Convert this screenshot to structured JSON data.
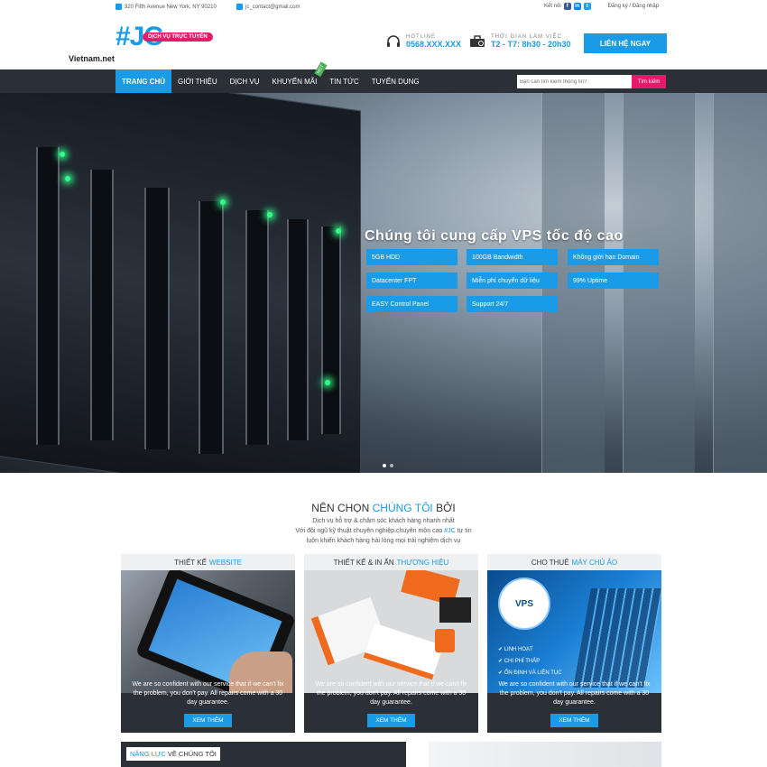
{
  "topbar": {
    "address": "320 Fifth Avenue New York, NY 90210",
    "email": "jc_contact@gmail.com",
    "connect_label": "Kết nối",
    "auth": "Đăng ký / Đăng nhập",
    "social": [
      "facebook-icon",
      "messenger-icon",
      "twitter-icon"
    ]
  },
  "header": {
    "logo_mark": "#JC",
    "logo_tag": "DỊCH VỤ TRỰC TUYẾN",
    "site_name": "Vietnam.net",
    "hotline_label": "HOTLINE",
    "hotline_value": "0568.XXX.XXX",
    "hours_label": "THỜI GIAN LÀM VIỆC",
    "hours_value": "T2 - T7: 8h30 - 20h30",
    "cta": "LIÊN HỆ NGAY"
  },
  "nav": {
    "items": [
      "TRANG CHỦ",
      "GIỚI THIỆU",
      "DỊCH VỤ",
      "KHUYẾN MÃI",
      "TIN TỨC",
      "TUYỂN DỤNG"
    ],
    "hot_badge": "HOT",
    "search_placeholder": "Bạn cần tìm kiếm thông tin?",
    "search_button": "Tìm kiếm"
  },
  "hero": {
    "title": "Chúng tôi cung cấp VPS tốc độ cao",
    "features": [
      "5GB HDD",
      "100GB Bandwidth",
      "Không giới hạn Domain",
      "Datacenter FPT",
      "Miễn phí chuyển dữ liệu",
      "99% Uptime",
      "EASY Control Panel",
      "Support 24/7"
    ]
  },
  "why": {
    "title_a": "NÊN CHỌN ",
    "title_hl": "CHÚNG TÔI",
    "title_b": " BỞI",
    "line1": "Dịch vụ hỗ trợ & chăm sóc khách hàng nhanh nhất",
    "line2_a": "Với đội ngũ kỹ thuật chuyên nghiệp,chuyên môn cao ",
    "line2_hl": "#JC",
    "line2_b": " tự tin",
    "line3": "luôn khiến khách hàng hài lòng mọi trải nghiệm dịch vụ"
  },
  "cards": [
    {
      "title": "THIẾT KẾ",
      "title_hl": "WEBSITE",
      "desc": "We are so confident with our service that if we can't fix the problem, you don't pay. All repairs come with a 30 day guarantee.",
      "button": "XEM THÊM"
    },
    {
      "title": "THIẾT KẾ & IN ẤN",
      "title_hl": "THƯƠNG HIỆU",
      "desc": "We are so confident with our service that if we can't fix the problem, you don't pay. All repairs come with a 30 day guarantee.",
      "button": "XEM THÊM"
    },
    {
      "title": "CHO THUÊ",
      "title_hl": "MÁY CHỦ ẢO",
      "desc": "We are so confident with our service that if we can't fix the problem, you don't pay. All repairs come with a 30 day guarantee.",
      "button": "XEM THÊM",
      "vps_badge": "VPS",
      "vps_list": [
        "LINH HOẠT",
        "CHI PHÍ THẤP",
        "ỔN ĐỊNH VÀ LIÊN TỤC"
      ]
    }
  ],
  "capability": {
    "hl": "NĂNG LỰC",
    "rest": " VỀ CHÚNG TÔI"
  },
  "colors": {
    "accent": "#1a9be8",
    "pink": "#e8196a",
    "dark": "#2b2f36"
  }
}
